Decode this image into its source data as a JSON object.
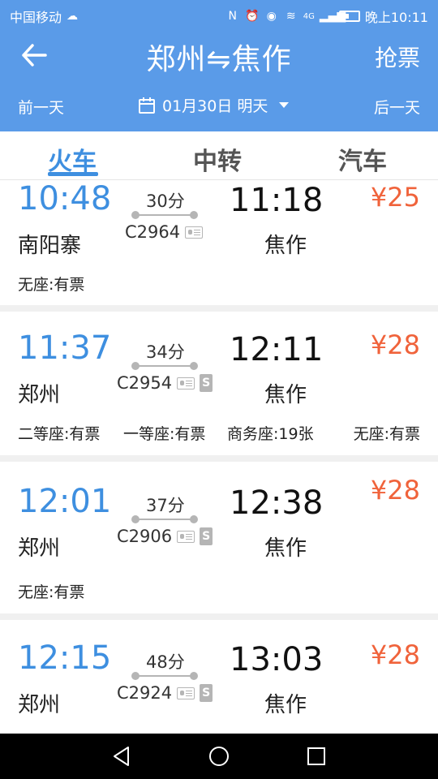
{
  "status_bar": {
    "carrier": "中国移动",
    "signal_label": "4G",
    "time": "晚上10:11"
  },
  "header": {
    "title": "郑州⇋焦作",
    "grab_ticket": "抢票",
    "prev_day": "前一天",
    "date": "01月30日 明天",
    "next_day": "后一天"
  },
  "tabs": [
    {
      "label": "火车",
      "active": true
    },
    {
      "label": "中转",
      "active": false
    },
    {
      "label": "汽车",
      "active": false
    }
  ],
  "trains": [
    {
      "dep_time": "10:48",
      "dep_station": "南阳寨",
      "duration": "30分",
      "train_no": "C2964",
      "arr_time": "11:18",
      "arr_station": "焦作",
      "price": "¥25",
      "seats": [
        "无座:有票"
      ]
    },
    {
      "dep_time": "11:37",
      "dep_station": "郑州",
      "duration": "34分",
      "train_no": "C2954",
      "arr_time": "12:11",
      "arr_station": "焦作",
      "price": "¥28",
      "seats": [
        "二等座:有票",
        "一等座:有票",
        "商务座:19张",
        "无座:有票"
      ]
    },
    {
      "dep_time": "12:01",
      "dep_station": "郑州",
      "duration": "37分",
      "train_no": "C2906",
      "arr_time": "12:38",
      "arr_station": "焦作",
      "price": "¥28",
      "seats": [
        "无座:有票"
      ]
    },
    {
      "dep_time": "12:15",
      "dep_station": "郑州",
      "duration": "48分",
      "train_no": "C2924",
      "arr_time": "13:03",
      "arr_station": "焦作",
      "price": "¥28",
      "seats": []
    }
  ],
  "colors": {
    "header_bg": "#5a9be8",
    "accent": "#3e8fe0",
    "price": "#f0633b"
  }
}
